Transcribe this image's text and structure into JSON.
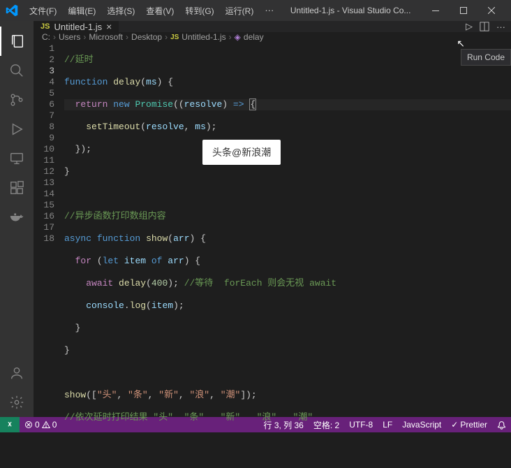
{
  "titlebar": {
    "menu": [
      "文件(F)",
      "编辑(E)",
      "选择(S)",
      "查看(V)",
      "转到(G)",
      "运行(R)"
    ],
    "more": "···",
    "title": "Untitled-1.js - Visual Studio Co..."
  },
  "tab": {
    "icon": "JS",
    "name": "Untitled-1.js",
    "close": "×"
  },
  "breadcrumbs": {
    "items": [
      "C:",
      "Users",
      "Microsoft",
      "Desktop"
    ],
    "file_icon": "JS",
    "file": "Untitled-1.js",
    "symbol": "delay"
  },
  "tooltip": "Run Code",
  "watermark": "头条@新浪潮",
  "tab_actions": {
    "run": "▷",
    "more": "···"
  },
  "lines": [
    "1",
    "2",
    "3",
    "4",
    "5",
    "6",
    "7",
    "8",
    "9",
    "10",
    "11",
    "12",
    "13",
    "14",
    "15",
    "16",
    "17",
    "18"
  ],
  "statusbar": {
    "errors": "0",
    "warnings": "0",
    "cursor": "行 3, 列 36",
    "spaces": "空格: 2",
    "encoding": "UTF-8",
    "eol": "LF",
    "lang": "JavaScript",
    "prettier": "Prettier"
  }
}
